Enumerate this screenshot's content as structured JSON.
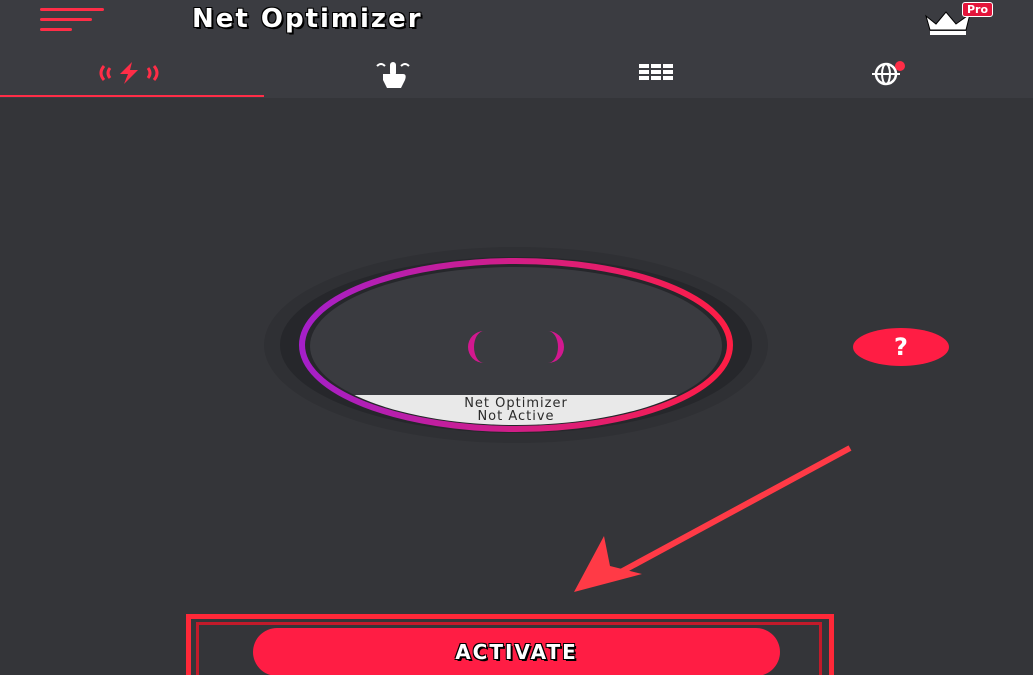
{
  "header": {
    "title": "Net Optimizer",
    "pro_label": "Pro",
    "menu_icon": "hamburger-menu-icon",
    "pro_icon": "crown-icon"
  },
  "tabs": [
    {
      "icon": "lightning-signal-icon",
      "active": true
    },
    {
      "icon": "hand-tap-icon",
      "active": false
    },
    {
      "icon": "grid-icon",
      "active": false
    },
    {
      "icon": "globe-icon",
      "active": false
    }
  ],
  "dial": {
    "status_line1": "Net Optimizer",
    "status_line2": "Not Active"
  },
  "help": {
    "label": "?"
  },
  "action": {
    "label": "ACTIVATE"
  },
  "colors": {
    "accent": "#ff1d44",
    "background": "#343539",
    "header": "#3b3c41",
    "ring_start": "#a51fc9",
    "ring_end": "#ff1d44"
  }
}
